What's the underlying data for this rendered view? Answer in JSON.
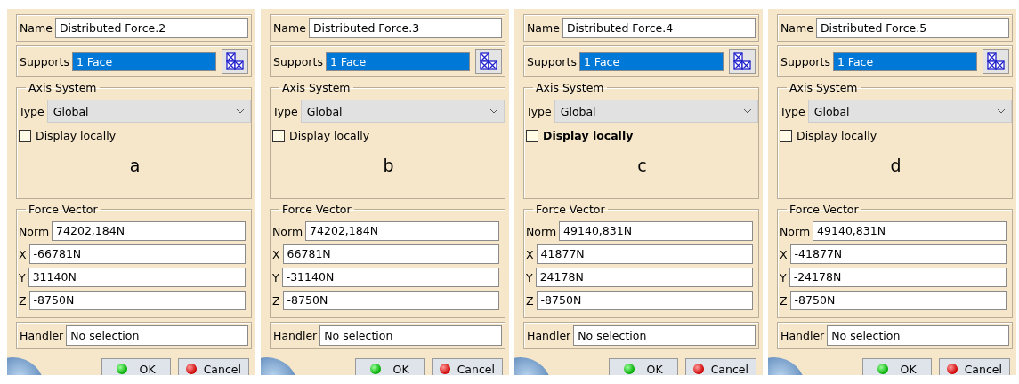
{
  "panels": [
    {
      "caption": "a",
      "name_label": "Name",
      "name": "Distributed Force.2",
      "supports_label": "Supports",
      "supports": "1 Face",
      "axis_title": "Axis System",
      "type_label": "Type",
      "type": "Global",
      "display_locally": {
        "label": "Display locally",
        "checked": false,
        "focused": false
      },
      "force_title": "Force Vector",
      "fields": [
        {
          "label": "Norm",
          "value": "74202,184N"
        },
        {
          "label": "X",
          "value": "-66781N"
        },
        {
          "label": "Y",
          "value": "31140N"
        },
        {
          "label": "Z",
          "value": "-8750N"
        }
      ],
      "handler_label": "Handler",
      "handler": "No selection",
      "buttons": [
        {
          "kind": "ok",
          "label": "OK"
        },
        {
          "kind": "cancel",
          "label": "Cancel"
        }
      ]
    },
    {
      "caption": "b",
      "name_label": "Name",
      "name": "Distributed Force.3",
      "supports_label": "Supports",
      "supports": "1 Face",
      "axis_title": "Axis System",
      "type_label": "Type",
      "type": "Global",
      "display_locally": {
        "label": "Display locally",
        "checked": false,
        "focused": false
      },
      "force_title": "Force Vector",
      "fields": [
        {
          "label": "Norm",
          "value": "74202,184N"
        },
        {
          "label": "X",
          "value": "66781N"
        },
        {
          "label": "Y",
          "value": "-31140N"
        },
        {
          "label": "Z",
          "value": "-8750N"
        }
      ],
      "handler_label": "Handler",
      "handler": "No selection",
      "buttons": [
        {
          "kind": "ok",
          "label": "OK"
        },
        {
          "kind": "cancel",
          "label": "Cancel"
        }
      ]
    },
    {
      "caption": "c",
      "name_label": "Name",
      "name": "Distributed Force.4",
      "supports_label": "Supports",
      "supports": "1 Face",
      "axis_title": "Axis System",
      "type_label": "Type",
      "type": "Global",
      "display_locally": {
        "label": "Display locally",
        "checked": false,
        "focused": true
      },
      "force_title": "Force Vector",
      "fields": [
        {
          "label": "Norm",
          "value": "49140,831N"
        },
        {
          "label": "X",
          "value": "41877N"
        },
        {
          "label": "Y",
          "value": "24178N"
        },
        {
          "label": "Z",
          "value": "-8750N"
        }
      ],
      "handler_label": "Handler",
      "handler": "No selection",
      "buttons": [
        {
          "kind": "ok",
          "label": "OK"
        },
        {
          "kind": "cancel",
          "label": "Cancel"
        }
      ]
    },
    {
      "caption": "d",
      "name_label": "Name",
      "name": "Distributed Force.5",
      "supports_label": "Supports",
      "supports": "1 Face",
      "axis_title": "Axis System",
      "type_label": "Type",
      "type": "Global",
      "display_locally": {
        "label": "Display locally",
        "checked": false,
        "focused": false
      },
      "force_title": "Force Vector",
      "fields": [
        {
          "label": "Norm",
          "value": "49140,831N"
        },
        {
          "label": "X",
          "value": "-41877N"
        },
        {
          "label": "Y",
          "value": "-24178N"
        },
        {
          "label": "Z",
          "value": "-8750N"
        }
      ],
      "handler_label": "Handler",
      "handler": "No selection",
      "buttons": [
        {
          "kind": "ok",
          "label": "OK"
        },
        {
          "kind": "cancel",
          "label": "Cancel"
        }
      ]
    }
  ]
}
